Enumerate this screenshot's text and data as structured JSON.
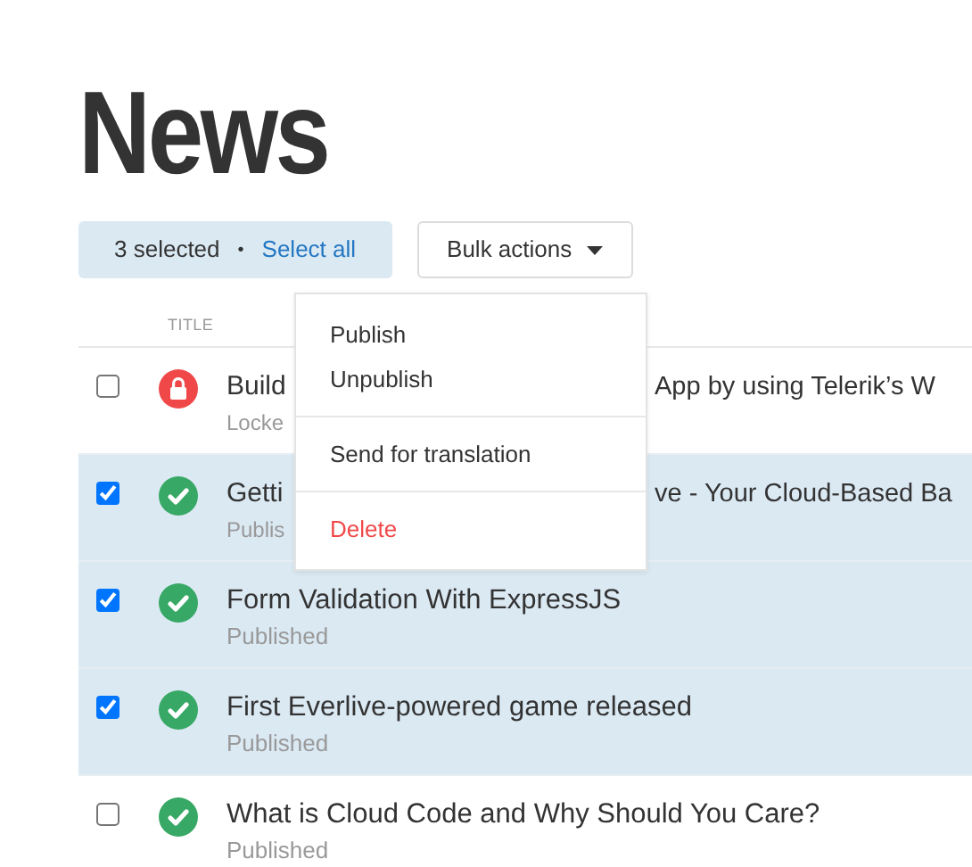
{
  "page_title": "News",
  "selection": {
    "count_text": "3 selected",
    "bullet": "•",
    "select_all": "Select all"
  },
  "bulk_actions": {
    "label": "Bulk actions",
    "expanded": true,
    "menu": [
      {
        "kind": "item",
        "label": "Publish"
      },
      {
        "kind": "item",
        "label": "Unpublish"
      },
      {
        "kind": "divider"
      },
      {
        "kind": "item",
        "label": "Send for translation"
      },
      {
        "kind": "divider"
      },
      {
        "kind": "danger",
        "label": "Delete"
      }
    ]
  },
  "table": {
    "columns": [
      "TITLE"
    ],
    "rows": [
      {
        "checked": false,
        "kind": "locked",
        "title_left": "Build",
        "title_right": "App by using Telerik’s W",
        "subtitle": "Locke"
      },
      {
        "checked": true,
        "kind": "published",
        "title_left": "Getti",
        "title_right": "ve - Your Cloud-Based Ba",
        "subtitle": "Publis"
      },
      {
        "checked": true,
        "kind": "published",
        "title": "Form Validation With ExpressJS",
        "subtitle": "Published"
      },
      {
        "checked": true,
        "kind": "published",
        "title": "First Everlive-powered game released",
        "subtitle": "Published"
      },
      {
        "checked": false,
        "kind": "published",
        "title": "What is Cloud Code and Why Should You Care?",
        "subtitle": "Published"
      }
    ]
  }
}
